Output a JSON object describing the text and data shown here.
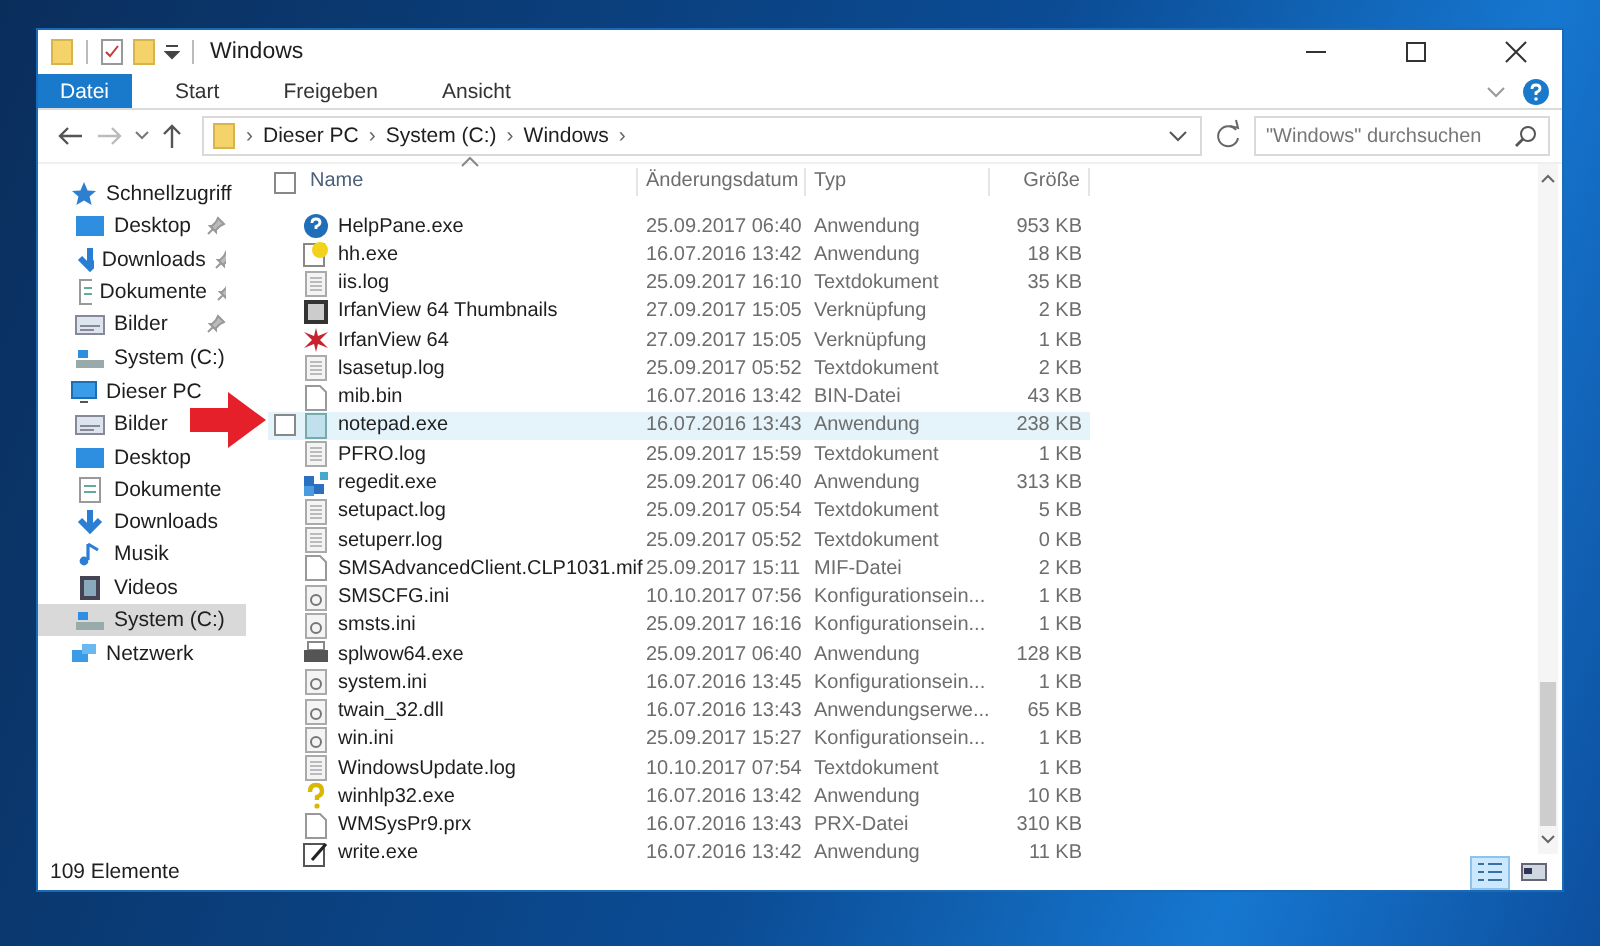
{
  "window": {
    "title": "Windows"
  },
  "ribbon_tabs": [
    {
      "label": "Datei",
      "selected": true
    },
    {
      "label": "Start",
      "selected": false
    },
    {
      "label": "Freigeben",
      "selected": false
    },
    {
      "label": "Ansicht",
      "selected": false
    }
  ],
  "address_bar": {
    "path": [
      "Dieser PC",
      "System (C:)",
      "Windows"
    ],
    "separator": "›"
  },
  "search": {
    "placeholder": "\"Windows\" durchsuchen"
  },
  "sidebar": {
    "items": [
      {
        "label": "Schnellzugriff",
        "kind": "star",
        "selected": false,
        "children": [
          {
            "label": "Desktop",
            "kind": "desktop",
            "pinned": true,
            "selected": false
          },
          {
            "label": "Downloads",
            "kind": "download",
            "pinned": true,
            "selected": false
          },
          {
            "label": "Dokumente",
            "kind": "document",
            "pinned": true,
            "selected": false
          },
          {
            "label": "Bilder",
            "kind": "pictures",
            "pinned": true,
            "selected": false
          },
          {
            "label": "System (C:)",
            "kind": "drive",
            "pinned": false,
            "selected": false
          }
        ]
      },
      {
        "label": "Dieser PC",
        "kind": "pc",
        "selected": false,
        "children": [
          {
            "label": "Bilder",
            "kind": "pictures",
            "pinned": false,
            "selected": false
          },
          {
            "label": "Desktop",
            "kind": "desktop",
            "pinned": false,
            "selected": false
          },
          {
            "label": "Dokumente",
            "kind": "document",
            "pinned": false,
            "selected": false
          },
          {
            "label": "Downloads",
            "kind": "download",
            "pinned": false,
            "selected": false
          },
          {
            "label": "Musik",
            "kind": "music",
            "pinned": false,
            "selected": false
          },
          {
            "label": "Videos",
            "kind": "video",
            "pinned": false,
            "selected": false
          },
          {
            "label": "System (C:)",
            "kind": "drive",
            "pinned": false,
            "selected": true
          }
        ]
      },
      {
        "label": "Netzwerk",
        "kind": "network",
        "selected": false
      }
    ]
  },
  "table": {
    "select_all": {
      "checked": false
    },
    "columns": [
      "Name",
      "Änderungsdatum",
      "Typ",
      "Größe"
    ],
    "rows": [
      {
        "name": "HelpPane.exe",
        "date": "25.09.2017 06:40",
        "type": "Anwendung",
        "size": "953 KB",
        "kind": "help",
        "selected": false
      },
      {
        "name": "hh.exe",
        "date": "16.07.2016 13:42",
        "type": "Anwendung",
        "size": "18 KB",
        "kind": "helpfile",
        "selected": false
      },
      {
        "name": "iis.log",
        "date": "25.09.2017 16:10",
        "type": "Textdokument",
        "size": "35 KB",
        "kind": "text",
        "selected": false
      },
      {
        "name": "IrfanView 64 Thumbnails",
        "date": "27.09.2017 15:05",
        "type": "Verknüpfung",
        "size": "2 KB",
        "kind": "thumbs",
        "selected": false
      },
      {
        "name": "IrfanView 64",
        "date": "27.09.2017 15:05",
        "type": "Verknüpfung",
        "size": "1 KB",
        "kind": "splat",
        "selected": false
      },
      {
        "name": "lsasetup.log",
        "date": "25.09.2017 05:52",
        "type": "Textdokument",
        "size": "2 KB",
        "kind": "text",
        "selected": false
      },
      {
        "name": "mib.bin",
        "date": "16.07.2016 13:42",
        "type": "BIN-Datei",
        "size": "43 KB",
        "kind": "blank",
        "selected": false
      },
      {
        "name": "notepad.exe",
        "date": "16.07.2016 13:43",
        "type": "Anwendung",
        "size": "238 KB",
        "kind": "notepad",
        "selected": true
      },
      {
        "name": "PFRO.log",
        "date": "25.09.2017 15:59",
        "type": "Textdokument",
        "size": "1 KB",
        "kind": "text",
        "selected": false
      },
      {
        "name": "regedit.exe",
        "date": "25.09.2017 06:40",
        "type": "Anwendung",
        "size": "313 KB",
        "kind": "regedit",
        "selected": false
      },
      {
        "name": "setupact.log",
        "date": "25.09.2017 05:54",
        "type": "Textdokument",
        "size": "5 KB",
        "kind": "text",
        "selected": false
      },
      {
        "name": "setuperr.log",
        "date": "25.09.2017 05:52",
        "type": "Textdokument",
        "size": "0 KB",
        "kind": "text",
        "selected": false
      },
      {
        "name": "SMSAdvancedClient.CLP1031.mif",
        "date": "25.09.2017 15:11",
        "type": "MIF-Datei",
        "size": "2 KB",
        "kind": "blank",
        "selected": false
      },
      {
        "name": "SMSCFG.ini",
        "date": "10.10.2017 07:56",
        "type": "Konfigurationsein...",
        "size": "1 KB",
        "kind": "gear",
        "selected": false
      },
      {
        "name": "smsts.ini",
        "date": "25.09.2017 16:16",
        "type": "Konfigurationsein...",
        "size": "1 KB",
        "kind": "gear",
        "selected": false
      },
      {
        "name": "splwow64.exe",
        "date": "25.09.2017 06:40",
        "type": "Anwendung",
        "size": "128 KB",
        "kind": "printer",
        "selected": false
      },
      {
        "name": "system.ini",
        "date": "16.07.2016 13:45",
        "type": "Konfigurationsein...",
        "size": "1 KB",
        "kind": "gear",
        "selected": false
      },
      {
        "name": "twain_32.dll",
        "date": "16.07.2016 13:43",
        "type": "Anwendungserwe...",
        "size": "65 KB",
        "kind": "gear",
        "selected": false
      },
      {
        "name": "win.ini",
        "date": "25.09.2017 15:27",
        "type": "Konfigurationsein...",
        "size": "1 KB",
        "kind": "gear",
        "selected": false
      },
      {
        "name": "WindowsUpdate.log",
        "date": "10.10.2017 07:54",
        "type": "Textdokument",
        "size": "1 KB",
        "kind": "text",
        "selected": false
      },
      {
        "name": "winhlp32.exe",
        "date": "16.07.2016 13:42",
        "type": "Anwendung",
        "size": "10 KB",
        "kind": "question",
        "selected": false
      },
      {
        "name": "WMSysPr9.prx",
        "date": "16.07.2016 13:43",
        "type": "PRX-Datei",
        "size": "310 KB",
        "kind": "blank",
        "selected": false
      },
      {
        "name": "write.exe",
        "date": "16.07.2016 13:42",
        "type": "Anwendung",
        "size": "11 KB",
        "kind": "write",
        "selected": false
      }
    ]
  },
  "status_bar": {
    "count": "109 Elemente"
  },
  "views": [
    {
      "kind": "details",
      "selected": true
    },
    {
      "kind": "tiles",
      "selected": false
    }
  ]
}
